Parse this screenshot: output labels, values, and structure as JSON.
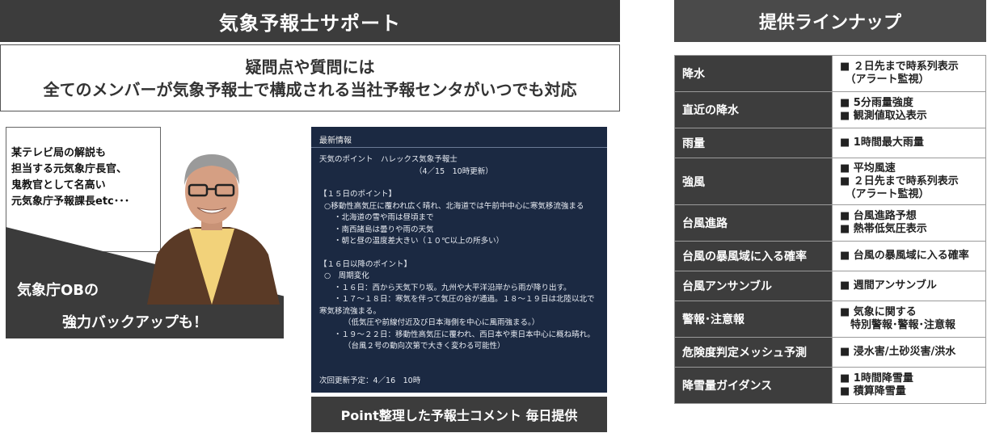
{
  "left_banner": "気象予報士サポート",
  "right_banner": "提供ラインナップ",
  "message": {
    "line1": "疑問点や質問には",
    "line2": "全てのメンバーが気象予報士で構成される当社予報センタがいつでも対応"
  },
  "bubble": {
    "lines": [
      "某テレビ局の解説も",
      "担当する元気象庁長官、",
      "鬼教官として名高い",
      "元気象庁予報課長etc･･･"
    ]
  },
  "ob_text": {
    "line1": "気象庁OBの",
    "line2": "強力バックアップも！"
  },
  "info_panel": {
    "header": "最新情報",
    "title": "天気のポイント　ハレックス気象予報士",
    "updated": "（4／15　10時更新）",
    "sec1": "【１５日のポイント】",
    "sec1_main": "○移動性高気圧に覆われ広く晴れ、北海道では午前中中心に寒気移流強まる",
    "sec1_b1": "・北海道の雪や雨は昼頃まで",
    "sec1_b2": "・南西諸島は曇りや雨の天気",
    "sec1_b3": "・朝と昼の温度差大きい（１０℃以上の所多い）",
    "sec2": "【１６日以降のポイント】",
    "sec2_head": "○　周期変化",
    "sec2_b1": "・１６日：西から天気下り坂。九州や大平洋沿岸から雨が降り出す。",
    "sec2_b2a": "・１７～１８日：寒気を伴って気圧の谷が通過。１８～１９日は北陸以北で",
    "sec2_b2b": "寒気移流強まる。",
    "sec2_b2c": "（低気圧や前線付近及び日本海側を中心に風雨強まる。）",
    "sec2_b3a": "・１９～２２日：移動性高気圧に覆われ、西日本や東日本中心に概ね晴れ。",
    "sec2_b3b": "（台風２号の動向次第で大きく変わる可能性）",
    "next": "次回更新予定：4／16　10時"
  },
  "info_caption": "Point整理した予報士コメント 毎日提供",
  "lineup": [
    {
      "name": "降水",
      "details": [
        "■ ２日先まで時系列表示",
        "　（アラート監視）"
      ]
    },
    {
      "name": "直近の降水",
      "details": [
        "■ 5分雨量強度",
        "■ 観測値取込表示"
      ]
    },
    {
      "name": "雨量",
      "details": [
        "■ 1時間最大雨量"
      ]
    },
    {
      "name": "強風",
      "details": [
        "■ 平均風速",
        "■ ２日先まで時系列表示",
        "　（アラート監視）"
      ]
    },
    {
      "name": "台風進路",
      "details": [
        "■ 台風進路予想",
        "■ 熱帯低気圧表示"
      ]
    },
    {
      "name": "台風の暴風域に入る確率",
      "details": [
        "■ 台風の暴風域に入る確率"
      ]
    },
    {
      "name": "台風アンサンブル",
      "details": [
        "■ 週間アンサンブル"
      ]
    },
    {
      "name": "警報･注意報",
      "details": [
        "■ 気象に関する",
        "　特別警報･警報･注意報"
      ]
    },
    {
      "name": "危険度判定メッシュ予測",
      "details": [
        "■ 浸水害/土砂災害/洪水"
      ]
    },
    {
      "name": "降雪量ガイダンス",
      "details": [
        "■ 1時間降雪量",
        "■ 積算降雪量"
      ]
    }
  ]
}
